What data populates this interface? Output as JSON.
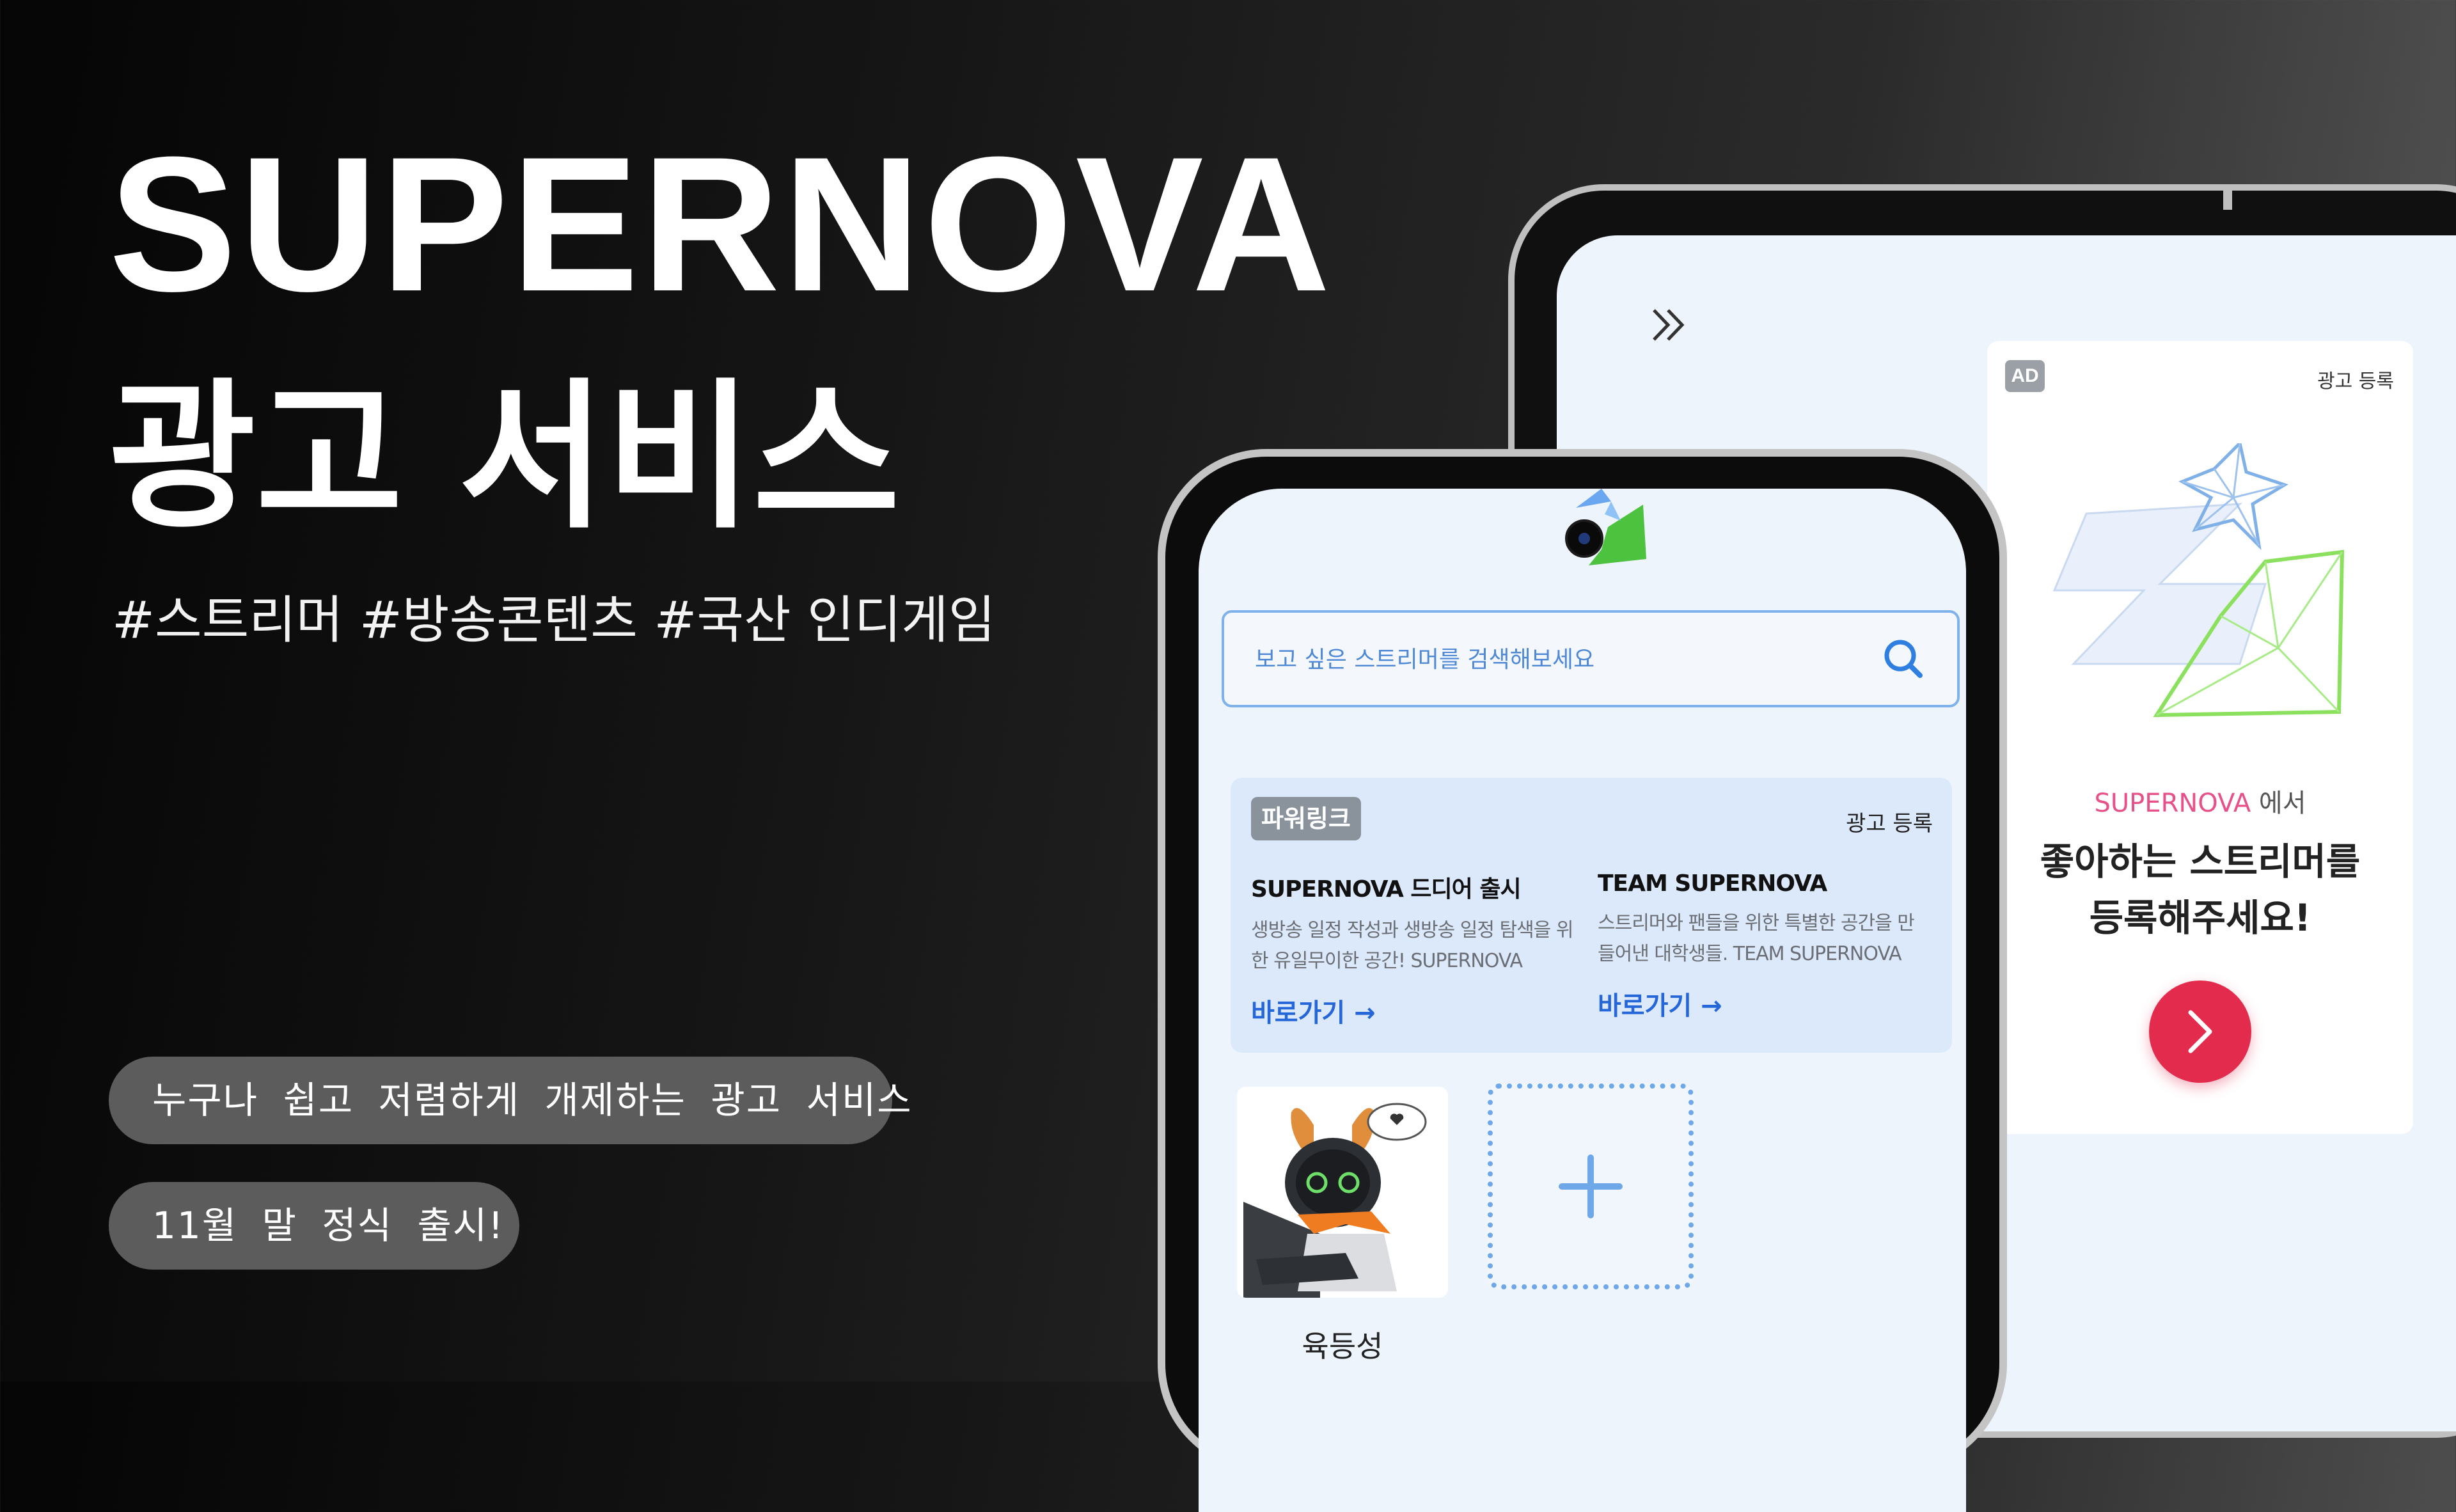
{
  "hero": {
    "title": "SUPERNOVA",
    "subtitle": "광고 서비스",
    "hashtags": "#스트리머 #방송콘텐츠 #국산 인디게임",
    "pill_1": "누구나 쉽고 저렴하게 개제하는 광고 서비스",
    "pill_2": "11월 말 정식 출시!"
  },
  "tablet": {
    "expand_icon": "double-chevron-right-icon",
    "ad_panel": {
      "badge": "AD",
      "register_link": "광고 등록",
      "brand": "SUPERNOVA",
      "brand_suffix": " 에서",
      "headline_line1": "좋아하는 스트리머를",
      "headline_line2": "등록해주세요!",
      "button_icon": "chevron-right-icon",
      "button_color": "#e32c4d"
    }
  },
  "phone": {
    "search": {
      "placeholder": "보고 싶은 스트리머를 검색해보세요",
      "icon": "search-icon"
    },
    "powerlink": {
      "badge": "파워링크",
      "register_link": "광고 등록",
      "items": [
        {
          "title": "SUPERNOVA 드디어 출시",
          "desc_line1": "생방송 일정 작성과 생방송 일정 탐색을 위",
          "desc_line2": "한 유일무이한 공간! SUPERNOVA",
          "link": "바로가기 →"
        },
        {
          "title": "TEAM SUPERNOVA",
          "desc_line1": "스트리머와 팬들을 위한 특별한 공간을 만",
          "desc_line2": "들어낸 대학생들. TEAM SUPERNOVA",
          "link": "바로가기 →"
        }
      ]
    },
    "streamer": {
      "name": "육등성"
    },
    "add_card_icon": "plus-icon"
  },
  "colors": {
    "accent_blue": "#2566d8",
    "search_border": "#7fb2ea",
    "brand_pink": "#e8508a"
  }
}
